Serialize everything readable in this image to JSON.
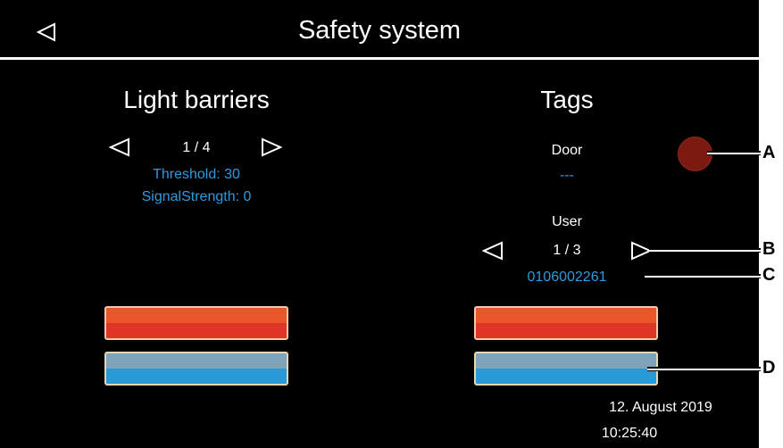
{
  "header": {
    "title": "Safety system",
    "back_icon": "back-triangle-icon"
  },
  "light_barriers": {
    "title": "Light barriers",
    "pager": "1 / 4",
    "threshold": "Threshold: 30",
    "signal_strength": "SignalStrength: 0"
  },
  "tags": {
    "title": "Tags",
    "door_label": "Door",
    "door_value": "---",
    "user_label": "User",
    "pager": "1 / 3",
    "tag_id": "0106002261"
  },
  "footer": {
    "date": "12. August 2019",
    "time": "10:25:40"
  },
  "callouts": [
    "A",
    "B",
    "C",
    "D"
  ],
  "colors": {
    "background": "#000000",
    "text_primary": "#ffffff",
    "text_value": "#2e9be0",
    "button_red_top": "#e8562a",
    "button_red_bottom": "#e03426",
    "button_blue_top": "#7fa3b8",
    "button_blue_bottom": "#289ad8",
    "indicator": "#7a1a10"
  }
}
